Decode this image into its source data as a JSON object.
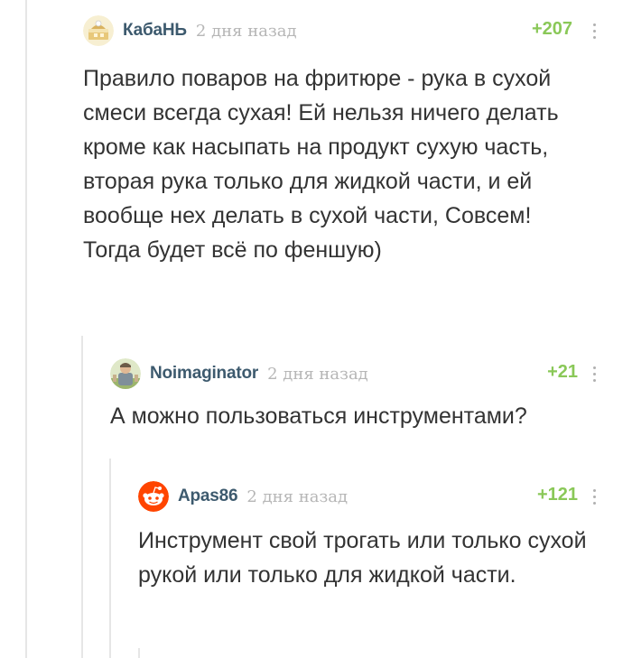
{
  "comments": [
    {
      "author": "КабаНЬ",
      "time": "2 дня назад",
      "rating": "+207",
      "avatar": "cake-avatar",
      "text": "Правило поваров на фритюре - рука в сухой смеси всегда сухая! Ей нельзя ничего делать кроме как насыпать на продукт сухую часть, вторая рука только для жидкой части, и ей вообще нех делать в сухой части, Совсем! Тогда будет всё по феншую)"
    },
    {
      "author": "Noimaginator",
      "time": "2 дня назад",
      "rating": "+21",
      "avatar": "person-avatar",
      "text": "А можно пользоваться инструментами?"
    },
    {
      "author": "Apas86",
      "time": "2 дня назад",
      "rating": "+121",
      "avatar": "reddit-alien-avatar",
      "text": "Инструмент свой трогать или только сухой рукой или только для жидкой части."
    }
  ],
  "colors": {
    "author": "#3d5a6e",
    "rating_positive": "#8ac858",
    "time": "#b6b6b6",
    "thread_line": "#e6e6e6",
    "text": "#333333"
  }
}
